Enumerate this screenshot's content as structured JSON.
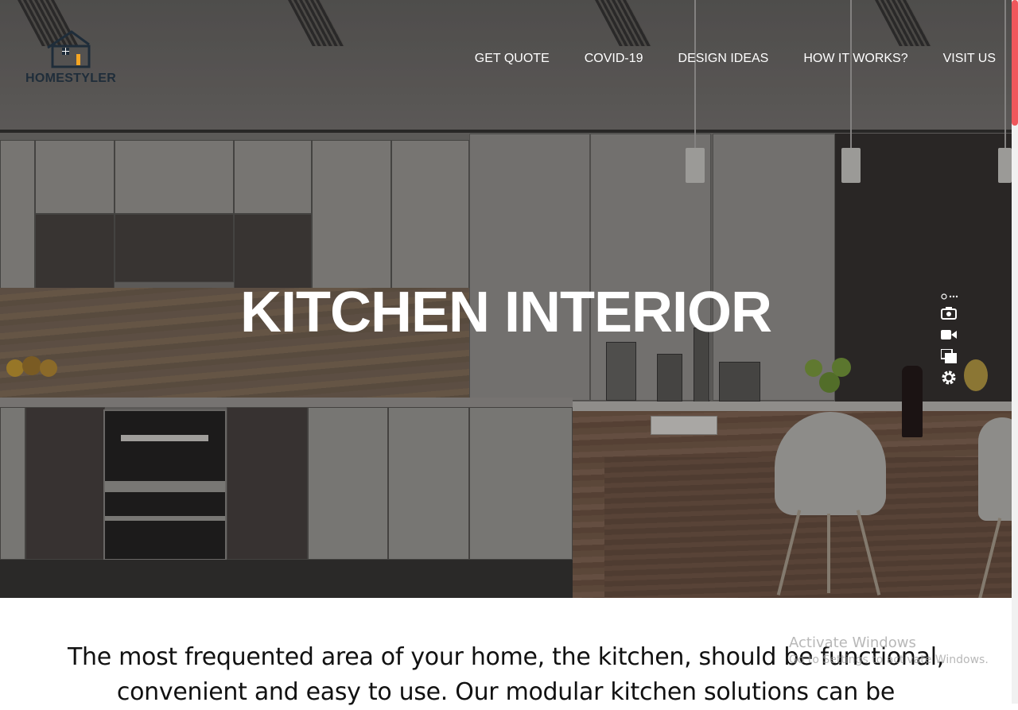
{
  "brand": {
    "name": "HOMESTYLER"
  },
  "nav": {
    "items": [
      "GET QUOTE",
      "COVID-19",
      "DESIGN IDEAS",
      "HOW IT WORKS?",
      "VISIT US"
    ]
  },
  "hero": {
    "title": "KITCHEN INTERIOR"
  },
  "intro": {
    "text": "The most frequented area of your home, the kitchen, should be functional, convenient and easy to use. Our modular kitchen solutions can be"
  },
  "tools": [
    "camera-icon",
    "video-icon",
    "copy-icon",
    "gear-icon"
  ],
  "watermark": {
    "line1": "Activate Windows",
    "line2": "Go to Settings to activate Windows."
  },
  "colors": {
    "accent": "#f0575c",
    "logo_dark": "#1f2d3a",
    "logo_window": "#f5a623"
  }
}
